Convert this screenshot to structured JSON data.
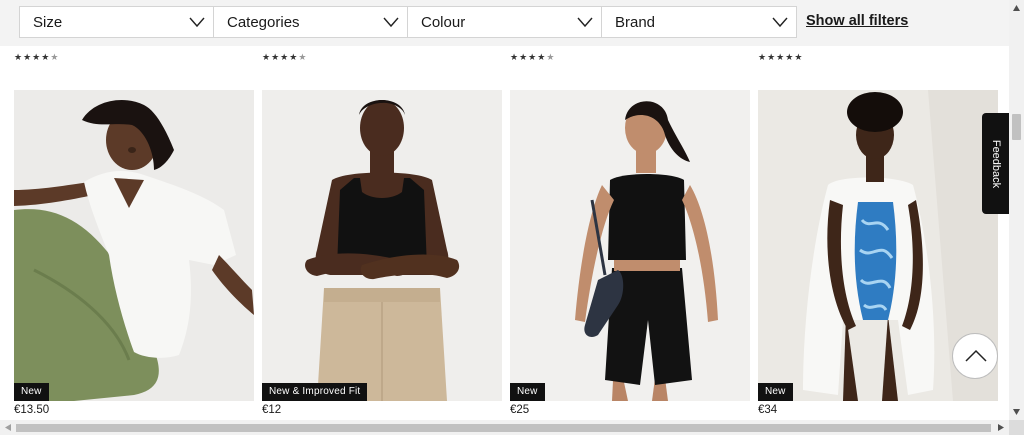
{
  "filters": [
    {
      "label": "Size"
    },
    {
      "label": "Categories"
    },
    {
      "label": "Colour"
    },
    {
      "label": "Brand"
    }
  ],
  "show_all_label": "Show all filters",
  "previous_row": [
    {
      "rating": 4.5
    },
    {
      "rating": 4.5
    },
    {
      "rating": 4.5
    },
    {
      "rating": 5
    }
  ],
  "products": [
    {
      "badge": "New",
      "price": "€13.50"
    },
    {
      "badge": "New & Improved Fit",
      "price": "€12"
    },
    {
      "badge": "New",
      "price": "€25"
    },
    {
      "badge": "New",
      "price": "€34"
    }
  ],
  "feedback_label": "Feedback",
  "icons": {
    "filter_chevron": "chevron-down-icon",
    "back_to_top": "chevron-up-icon"
  },
  "colors": {
    "filterbar_bg": "#f3f3f3",
    "badge_bg": "#111111",
    "feedback_bg": "#111111"
  }
}
